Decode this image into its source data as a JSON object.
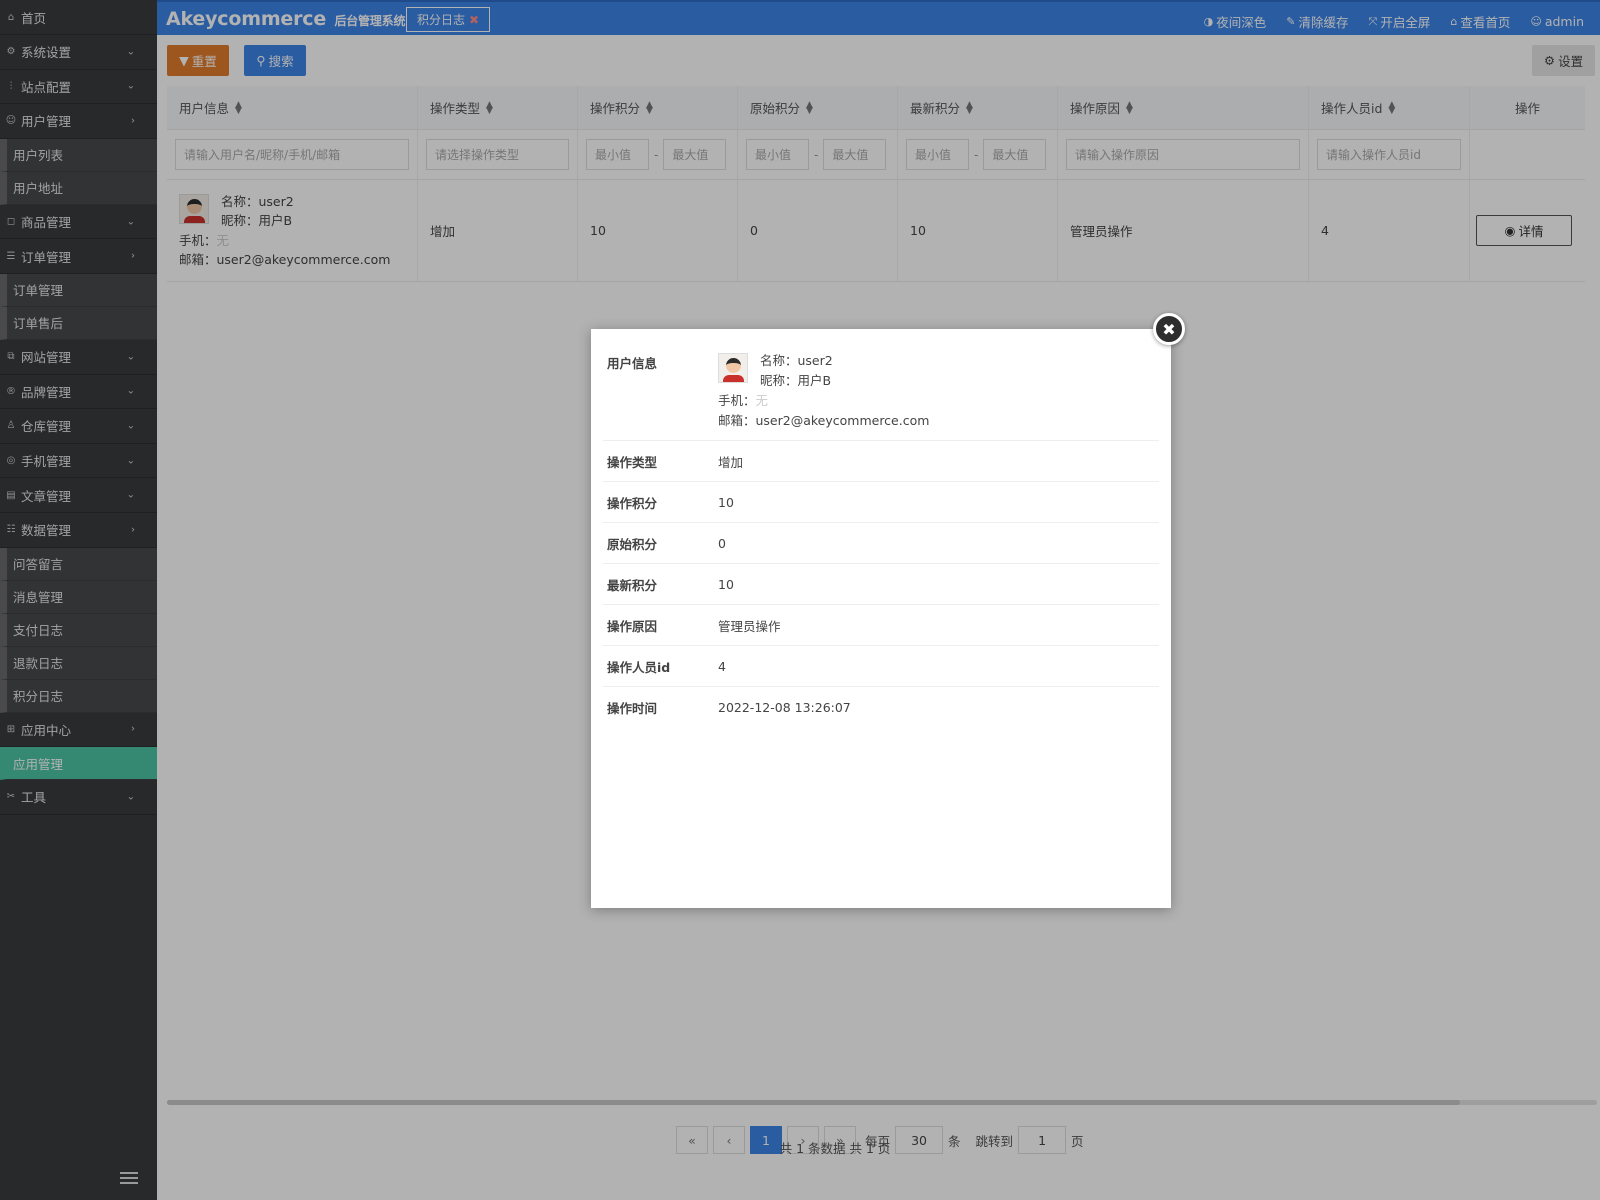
{
  "sidebar": {
    "home": "首页",
    "items": [
      {
        "label": "系统设置",
        "icon": "gear-icon"
      },
      {
        "label": "站点配置",
        "icon": "sliders-icon"
      },
      {
        "label": "用户管理",
        "icon": "user-icon"
      },
      {
        "label": "用户列表"
      },
      {
        "label": "用户地址"
      },
      {
        "label": "商品管理",
        "icon": "bag-icon"
      },
      {
        "label": "订单管理",
        "icon": "list-icon"
      },
      {
        "label": "订单管理"
      },
      {
        "label": "订单售后"
      },
      {
        "label": "网站管理",
        "icon": "link-icon"
      },
      {
        "label": "品牌管理",
        "icon": "registered-icon"
      },
      {
        "label": "仓库管理",
        "icon": "warehouse-icon"
      },
      {
        "label": "手机管理",
        "icon": "mobile-icon"
      },
      {
        "label": "文章管理",
        "icon": "article-icon"
      },
      {
        "label": "数据管理",
        "icon": "database-icon"
      },
      {
        "label": "问答留言"
      },
      {
        "label": "消息管理"
      },
      {
        "label": "支付日志"
      },
      {
        "label": "退款日志"
      },
      {
        "label": "积分日志"
      },
      {
        "label": "应用中心",
        "icon": "apps-icon"
      },
      {
        "label": "应用管理"
      },
      {
        "label": "工具",
        "icon": "tools-icon"
      }
    ]
  },
  "header": {
    "brand": "Akeycommerce",
    "brand_sub": "后台管理系统",
    "tab": "积分日志",
    "actions": {
      "night": "夜间深色",
      "clear": "清除缓存",
      "fullscreen": "开启全屏",
      "home": "查看首页",
      "user": "admin"
    }
  },
  "toolbar": {
    "reset": "重置",
    "search": "搜索",
    "settings": "设置"
  },
  "table": {
    "columns": [
      "用户信息",
      "操作类型",
      "操作积分",
      "原始积分",
      "最新积分",
      "操作原因",
      "操作人员id",
      "操作"
    ],
    "filters": {
      "user": "请输入用户名/昵称/手机/邮箱",
      "type": "请选择操作类型",
      "min": "最小值",
      "max": "最大值",
      "reason": "请输入操作原因",
      "operator": "请输入操作人员id"
    },
    "row": {
      "name": "名称：user2",
      "nickname": "昵称：用户B",
      "phone_label": "手机：",
      "phone_value": "无",
      "email": "邮箱：user2@akeycommerce.com",
      "type": "增加",
      "points": "10",
      "original": "0",
      "latest": "10",
      "reason": "管理员操作",
      "operator": "4",
      "detail": "详情"
    }
  },
  "pager": {
    "first": "«",
    "prev": "‹",
    "page": "1",
    "next": "›",
    "last": "»",
    "per_page_label": "每页",
    "per_page": "30",
    "per_page_unit": "条",
    "jump_label": "跳转到",
    "jump_value": "1",
    "jump_unit": "页",
    "summary": "共 1 条数据   共 1 页"
  },
  "modal": {
    "user_label": "用户信息",
    "name": "名称：user2",
    "nickname": "昵称：用户B",
    "phone_label": "手机：",
    "phone_value": "无",
    "email": "邮箱：user2@akeycommerce.com",
    "fields": [
      {
        "k": "操作类型",
        "v": "增加"
      },
      {
        "k": "操作积分",
        "v": "10"
      },
      {
        "k": "原始积分",
        "v": "0"
      },
      {
        "k": "最新积分",
        "v": "10"
      },
      {
        "k": "操作原因",
        "v": "管理员操作"
      },
      {
        "k": "操作人员id",
        "v": "4"
      },
      {
        "k": "操作时间",
        "v": "2022-12-08 13:26:07"
      }
    ],
    "close": "✖"
  },
  "colors": {
    "header": "#3d85e8",
    "sidebar": "#3a3b3e",
    "active": "#4cc3a3",
    "reset": "#e07b2c"
  }
}
